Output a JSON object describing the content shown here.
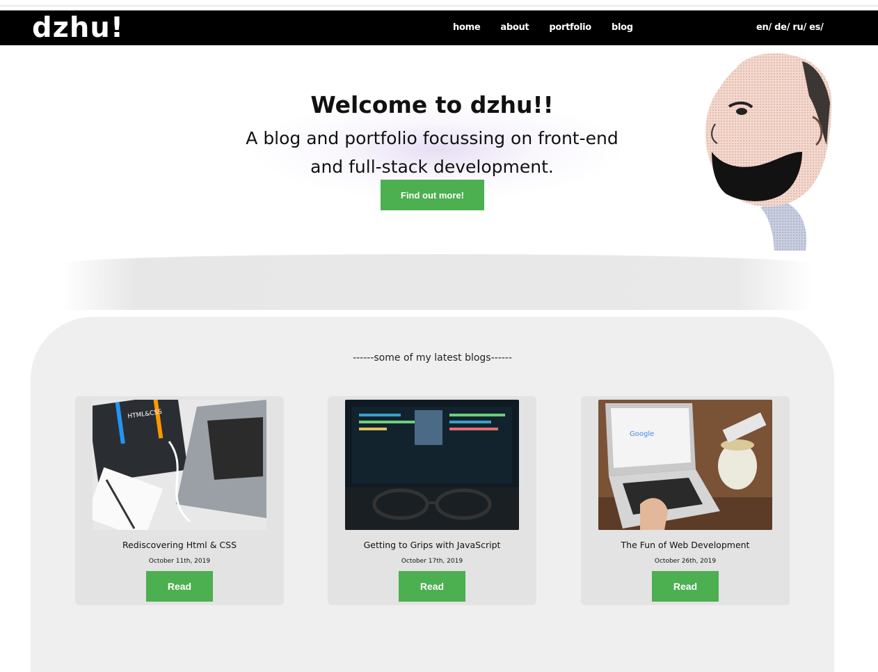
{
  "site": {
    "logo": "dzhu!"
  },
  "nav": {
    "links": [
      {
        "label": "home"
      },
      {
        "label": "about"
      },
      {
        "label": "portfolio"
      },
      {
        "label": "blog"
      }
    ],
    "languages": [
      "en",
      "de",
      "ru",
      "es"
    ]
  },
  "hero": {
    "title": "Welcome to dzhu!!",
    "subtitle_line1": "A blog and portfolio focussing on front-end",
    "subtitle_line2": "and full-stack development.",
    "button_label": "Find out more!"
  },
  "blogs": {
    "heading": "------some of my latest blogs------",
    "items": [
      {
        "title": "Rediscovering Html & CSS",
        "date": "October 11th, 2019",
        "button": "Read"
      },
      {
        "title": "Getting to Grips with JavaScript",
        "date": "October 17th, 2019",
        "button": "Read"
      },
      {
        "title": "The Fun of Web Development",
        "date": "October 26th, 2019",
        "button": "Read"
      }
    ]
  },
  "colors": {
    "accent": "#4caf50",
    "navbar": "#000000",
    "section_bg": "#efefef",
    "card_bg": "#e3e3e3"
  }
}
